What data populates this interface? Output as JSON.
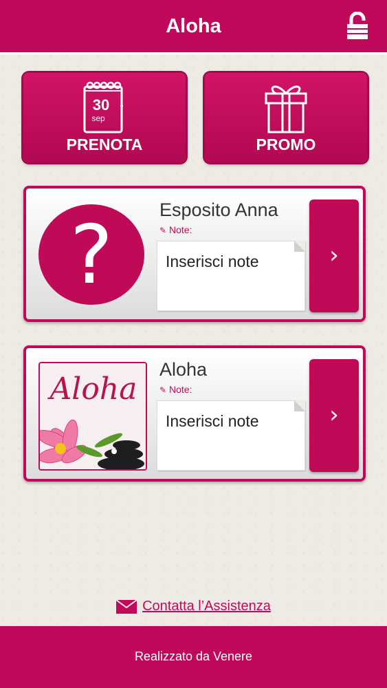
{
  "header": {
    "title": "Aloha",
    "lock_icon": "unlock-icon"
  },
  "actions": [
    {
      "label": "PRENOTA",
      "icon": "calendar-icon",
      "calendar_day": "30",
      "calendar_month": "sep"
    },
    {
      "label": "PROMO",
      "icon": "gift-icon"
    }
  ],
  "cards": [
    {
      "name": "Esposito Anna",
      "note_label": "Note:",
      "note_placeholder": "Inserisci note",
      "avatar": "question-mark"
    },
    {
      "name": "Aloha",
      "note_label": "Note:",
      "note_placeholder": "Inserisci note",
      "avatar": "aloha-logo",
      "logo_text": "Aloha"
    }
  ],
  "contact": {
    "label": "Contatta l’Assistenza",
    "icon": "mail-icon"
  },
  "footer": {
    "text": "Realizzato da Venere"
  },
  "colors": {
    "accent": "#c0095a",
    "background": "#eeebe5"
  }
}
